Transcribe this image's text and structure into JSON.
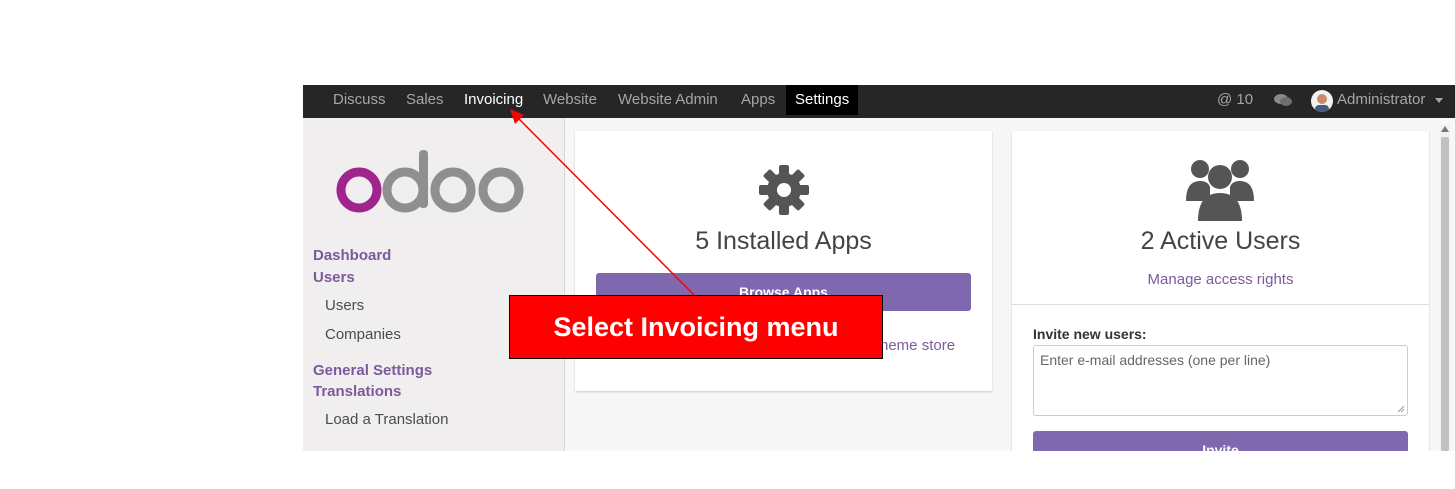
{
  "navbar": {
    "items": [
      {
        "label": "Discuss"
      },
      {
        "label": "Sales"
      },
      {
        "label": "Invoicing"
      },
      {
        "label": "Website"
      },
      {
        "label": "Website Admin"
      },
      {
        "label": "Apps"
      },
      {
        "label": "Settings"
      }
    ],
    "mention_count": "@ 10",
    "chat_icon": "chat-bubbles-icon",
    "user_name": "Administrator"
  },
  "sidebar": {
    "logo_text": "odoo",
    "sections": [
      {
        "label": "Dashboard"
      },
      {
        "label": "Users",
        "children": [
          "Users",
          "Companies"
        ]
      },
      {
        "label": "General Settings"
      },
      {
        "label": "Translations",
        "children": [
          "Load a Translation"
        ]
      }
    ]
  },
  "apps_card": {
    "icon": "gear-icon",
    "title": "5 Installed Apps",
    "browse_button": "Browse Apps",
    "theme_link_partial": "heme store"
  },
  "users_card": {
    "icon": "users-group-icon",
    "title": "2 Active Users",
    "manage_link": "Manage access rights",
    "invite_label": "Invite new users:",
    "invite_placeholder": "Enter e-mail addresses (one per line)",
    "invite_button": "Invite"
  },
  "annotation": {
    "text": "Select Invoicing menu",
    "color": "#ff0000"
  },
  "colors": {
    "navbar_bg": "#262626",
    "accent_purple": "#8068ae",
    "link_purple": "#7c5a9c"
  }
}
